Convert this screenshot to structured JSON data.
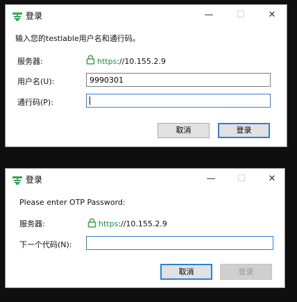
{
  "dialog1": {
    "title": "登录",
    "controls": {
      "minimize": "—",
      "maximize": "☐",
      "close": "✕"
    },
    "message": "输入您的testlable用户名和通行码。",
    "server_label": "服务器:",
    "server_protocol": "https",
    "server_host": "://10.155.2.9",
    "username_label": "用户名(U):",
    "username_value": "9990301",
    "password_label": "通行码(P):",
    "password_value": "",
    "cancel_label": "取消",
    "login_label": "登录"
  },
  "dialog2": {
    "title": "登录",
    "controls": {
      "minimize": "—",
      "maximize": "☐",
      "close": "✕"
    },
    "message": "Please enter OTP Password:",
    "server_label": "服务器:",
    "server_protocol": "https",
    "server_host": "://10.155.2.9",
    "next_code_label": "下一个代码(N):",
    "next_code_value": "",
    "cancel_label": "取消",
    "login_label": "登录"
  },
  "colors": {
    "accent": "#2d7fd3",
    "https_green": "#1a8f3a",
    "icon_green": "#3aa35a"
  }
}
